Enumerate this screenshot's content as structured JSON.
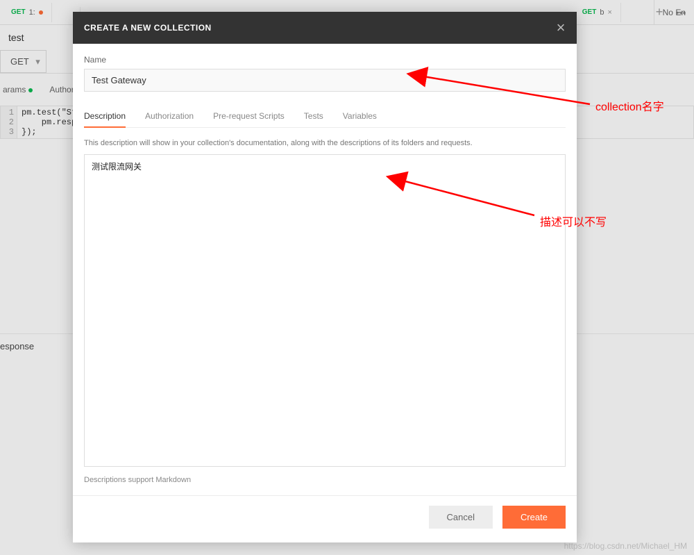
{
  "background": {
    "tabs": [
      {
        "method": "GET",
        "label": "1:"
      },
      {
        "method": "",
        "label": ""
      },
      {
        "method": "GET",
        "label": "b"
      }
    ],
    "noenv": "No En",
    "title": "test",
    "method": "GET",
    "subtabs": {
      "params": "arams",
      "auth": "Author"
    },
    "code": {
      "lines": [
        "1",
        "2",
        "3"
      ],
      "l1": "pm.test(\"Stat\"",
      "l2": "    pm.respon",
      "l3": "});"
    },
    "response": "esponse"
  },
  "dialog": {
    "title": "CREATE A NEW COLLECTION",
    "name_label": "Name",
    "name_value": "Test Gateway",
    "tabs": {
      "description": "Description",
      "authorization": "Authorization",
      "prerequest": "Pre-request Scripts",
      "tests": "Tests",
      "variables": "Variables"
    },
    "desc_helper": "This description will show in your collection's documentation, along with the descriptions of its folders and requests.",
    "desc_value": "测试限流网关",
    "md_hint": "Descriptions support Markdown",
    "buttons": {
      "cancel": "Cancel",
      "create": "Create"
    }
  },
  "annotations": {
    "name": "collection名字",
    "desc": "描述可以不写"
  },
  "watermark": "https://blog.csdn.net/Michael_HM"
}
